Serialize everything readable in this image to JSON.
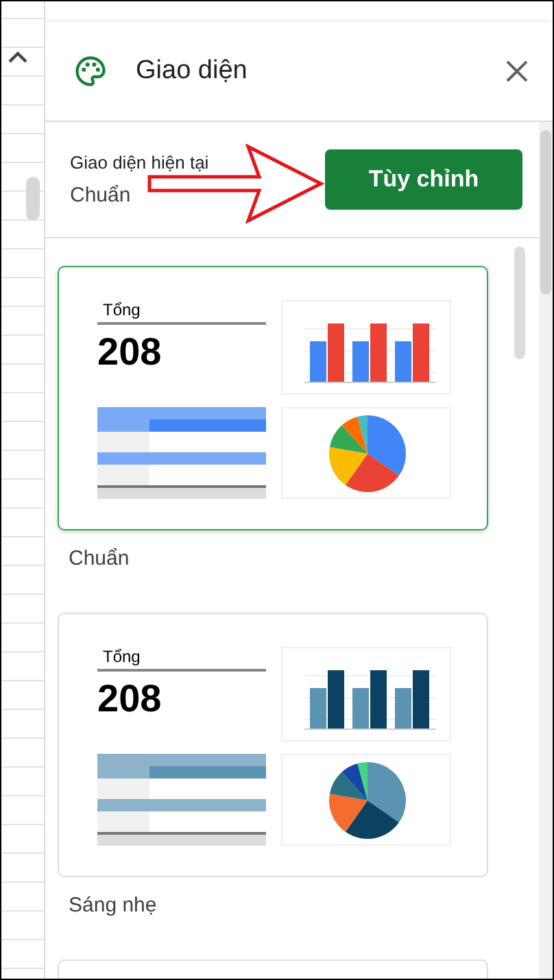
{
  "panel": {
    "title": "Giao diện",
    "current_label": "Giao diện hiện tại",
    "current_value": "Chuẩn",
    "customize_button": "Tùy chỉnh"
  },
  "themes": [
    {
      "name": "Chuẩn",
      "selected": true,
      "scorecard_label": "Tổng",
      "scorecard_value": "208",
      "palette": [
        {
          "color": "#4285f4"
        },
        {
          "color": "#ea4335"
        },
        {
          "color": "#fbbc04"
        },
        {
          "color": "#34a853"
        },
        {
          "color": "#ff6d01"
        },
        {
          "color": "#46bdc6"
        }
      ]
    },
    {
      "name": "Sáng nhẹ",
      "selected": false,
      "scorecard_label": "Tổng",
      "scorecard_value": "208",
      "palette": [
        {
          "color": "#5b93b2"
        },
        {
          "color": "#0b4261"
        },
        {
          "color": "#f46c2f"
        },
        {
          "color": "#2a7184"
        },
        {
          "color": "#1646a8"
        },
        {
          "color": "#45d483"
        }
      ]
    }
  ]
}
